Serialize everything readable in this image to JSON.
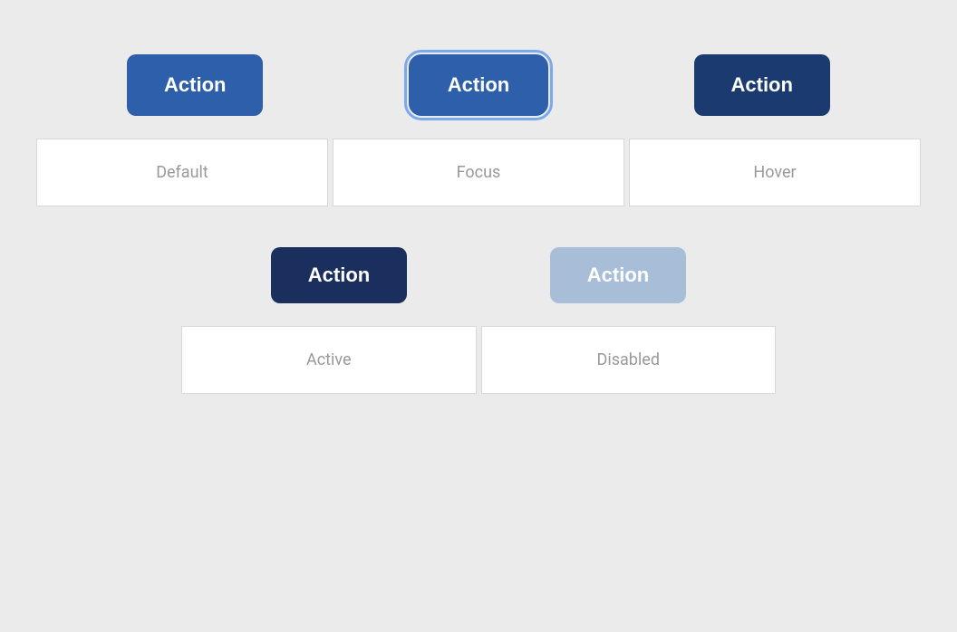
{
  "buttons": {
    "default": {
      "label": "Action",
      "state": "default"
    },
    "focus": {
      "label": "Action",
      "state": "focus"
    },
    "hover": {
      "label": "Action",
      "state": "hover"
    },
    "active": {
      "label": "Action",
      "state": "active"
    },
    "disabled": {
      "label": "Action",
      "state": "disabled"
    }
  },
  "labels": {
    "default": "Default",
    "focus": "Focus",
    "hover": "Hover",
    "active": "Active",
    "disabled": "Disabled"
  },
  "colors": {
    "background": "#ebebeb",
    "btn_default": "#2d5faa",
    "btn_hover": "#1a3a70",
    "btn_active": "#1a2f5e",
    "btn_disabled": "#a8bdd8",
    "btn_text": "#ffffff",
    "label_text": "#999999",
    "card_bg": "#ffffff",
    "card_border": "#d8d8d8"
  }
}
